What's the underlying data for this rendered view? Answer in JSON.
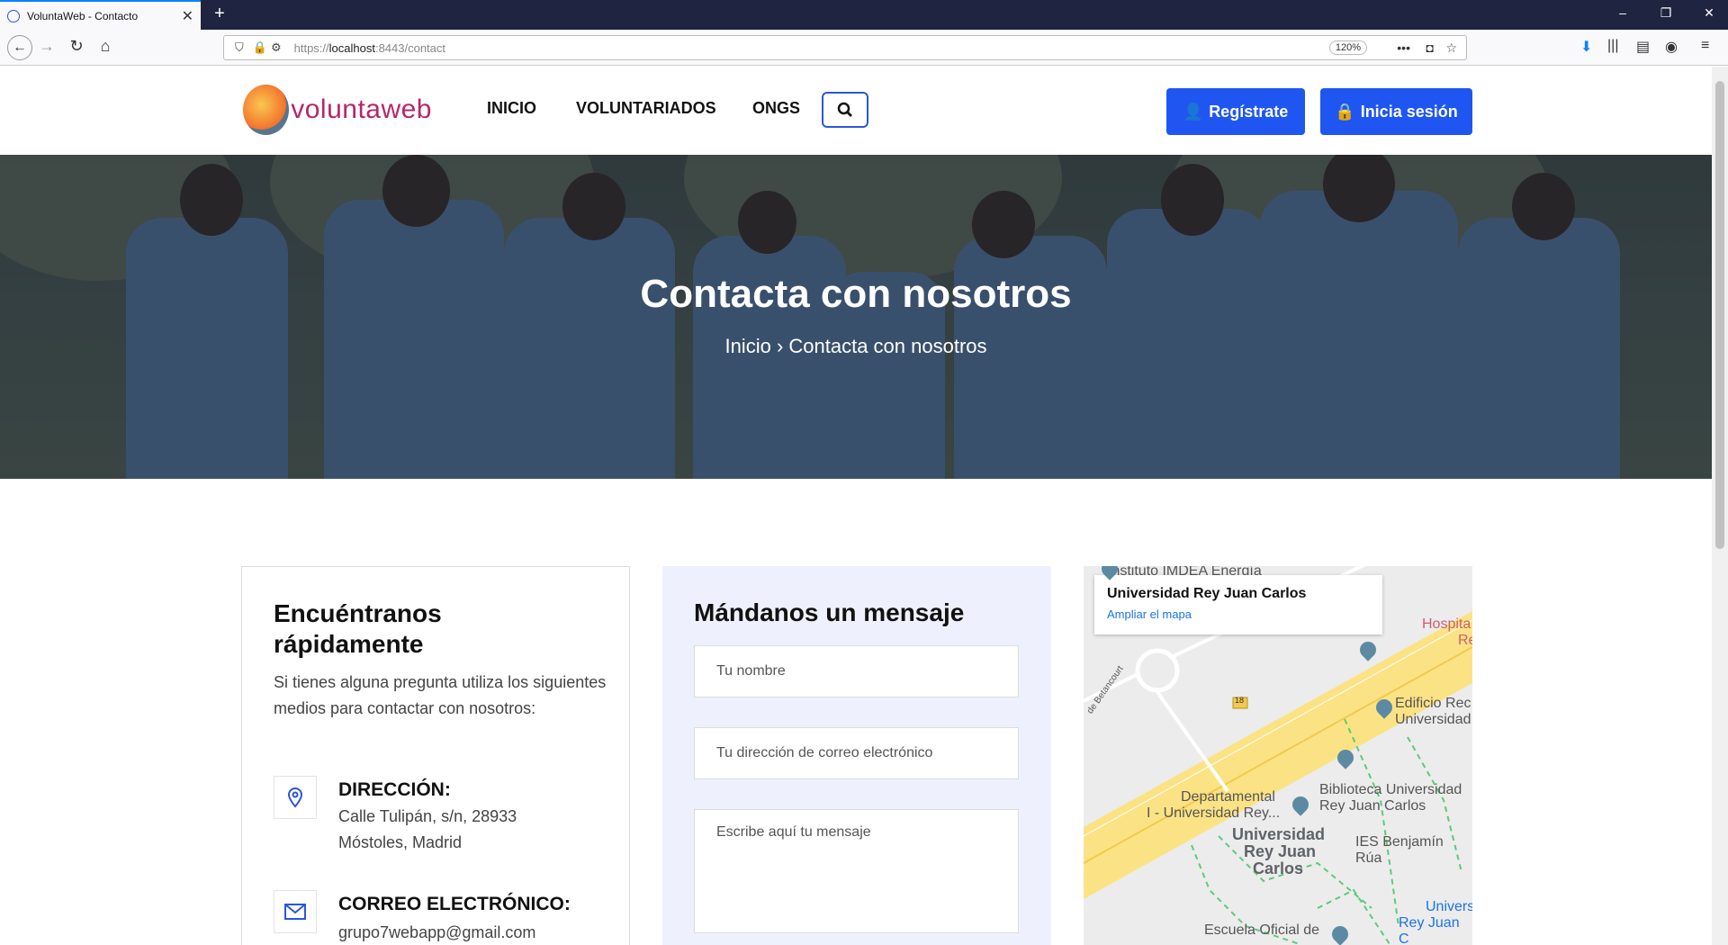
{
  "browser": {
    "tab_title": "VoluntaWeb - Contacto",
    "url_prefix": "https://",
    "url_host": "localhost",
    "url_rest": ":8443/contact",
    "zoom": "120%"
  },
  "header": {
    "logo_text": "voluntaweb",
    "menu": [
      "INICIO",
      "VOLUNTARIADOS",
      "ONGS"
    ],
    "register_label": "Regístrate",
    "login_label": "Inicia sesión"
  },
  "hero": {
    "title": "Contacta con nosotros",
    "breadcrumb_home": "Inicio",
    "breadcrumb_sep": "›",
    "breadcrumb_current": "Contacta con nosotros"
  },
  "find_us": {
    "title": "Encuéntranos rápidamente",
    "description": "Si tienes alguna pregunta utiliza los siguientes medios para contactar con nosotros:",
    "address_label": "DIRECCIÓN:",
    "address_value": "Calle Tulipán, s/n, 28933 Móstoles, Madrid",
    "email_label": "CORREO ELECTRÓNICO:",
    "email_value": "grupo7webapp@gmail.com"
  },
  "message_form": {
    "title": "Mándanos un mensaje",
    "name_placeholder": "Tu nombre",
    "email_placeholder": "Tu dirección de correo electrónico",
    "message_placeholder": "Escribe aquí tu mensaje"
  },
  "map": {
    "popup_title": "Universidad Rey Juan Carlos",
    "popup_link": "Ampliar el mapa",
    "labels": {
      "imdea": "Instituto IMDEA Energía",
      "hospital": "Hospita",
      "hospital2": "Re",
      "edificio": "Edificio Rec",
      "edificio2": "Universidad",
      "betancourt": "de Betancourt",
      "road_number": "18",
      "departamental": "Departamental",
      "departamental2": "I - Universidad Rey...",
      "biblioteca": "Biblioteca Universidad",
      "biblioteca2": "Rey Juan Carlos",
      "urjc1": "Universidad",
      "urjc2": "Rey Juan",
      "urjc3": "Carlos",
      "ies": "IES Benjamín Rúa",
      "univ_right": "Univers",
      "univ_right2": "Rey Juan C",
      "escuela": "Escuela Oficial de"
    }
  }
}
